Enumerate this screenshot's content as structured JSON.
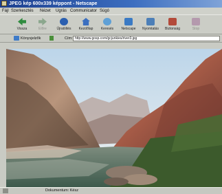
{
  "window": {
    "title": "JPEG kép 600x339 képpont - Netscape"
  },
  "menubar": {
    "items": [
      "Fájl",
      "Szerkesztés",
      "Nézet",
      "Ugrás",
      "Communicator",
      "Súgó"
    ]
  },
  "toolbar": {
    "buttons": [
      {
        "label": "Vissza",
        "icon": "back-arrow-icon",
        "enabled": true
      },
      {
        "label": "Előre",
        "icon": "forward-arrow-icon",
        "enabled": false
      },
      {
        "label": "Újratöltés",
        "icon": "reload-icon",
        "enabled": true
      },
      {
        "label": "Kezdőlap",
        "icon": "home-icon",
        "enabled": true
      },
      {
        "label": "Keresés",
        "icon": "search-icon",
        "enabled": true
      },
      {
        "label": "Netscape",
        "icon": "netscape-icon",
        "enabled": true
      },
      {
        "label": "Nyomtatás",
        "icon": "print-icon",
        "enabled": true
      },
      {
        "label": "Biztonság",
        "icon": "security-icon",
        "enabled": true
      },
      {
        "label": "Stop",
        "icon": "stop-icon",
        "enabled": false
      }
    ]
  },
  "location": {
    "bookmarks_label": "Könyvjelzők",
    "url_label": "Cím:",
    "url": "http://www.gosp.com/gcjunkies/river3.jpg"
  },
  "statusbar": {
    "text": "Dokumentum: Kész"
  },
  "colors": {
    "titlebar": "#1c3f8f",
    "chrome": "#c6c8c1"
  }
}
